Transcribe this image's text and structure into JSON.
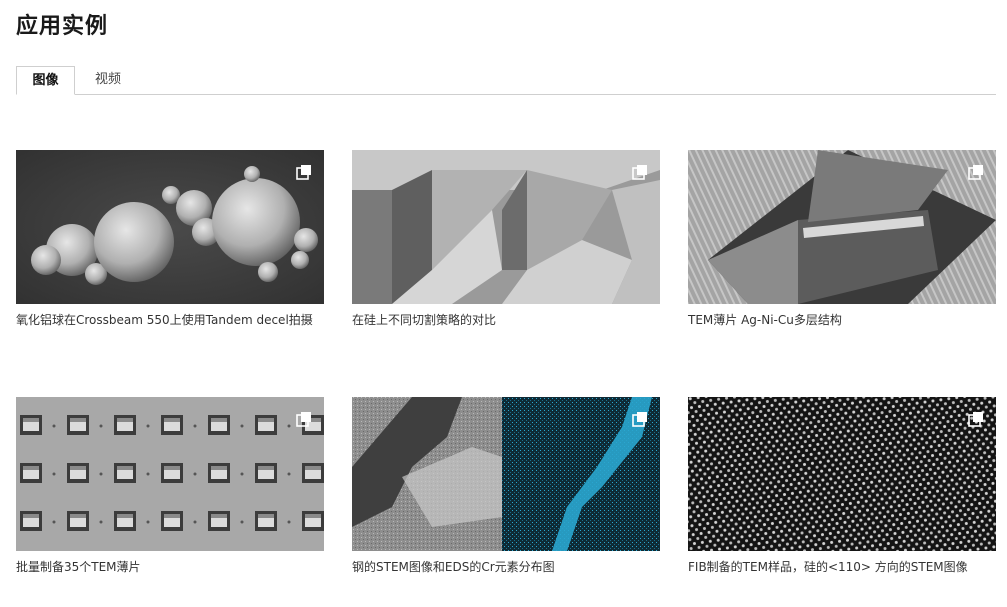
{
  "page": {
    "title": "应用实例"
  },
  "tabs": [
    {
      "label": "图像",
      "active": true
    },
    {
      "label": "视频",
      "active": false
    }
  ],
  "gallery": [
    {
      "caption": "氧化铝球在Crossbeam 550上使用Tandem decel拍摄",
      "icon": "expand-icon"
    },
    {
      "caption": "在硅上不同切割策略的对比",
      "icon": "expand-icon"
    },
    {
      "caption": "TEM薄片 Ag-Ni-Cu多层结构",
      "icon": "expand-icon"
    },
    {
      "caption": "批量制备35个TEM薄片",
      "icon": "expand-icon"
    },
    {
      "caption": "钢的STEM图像和EDS的Cr元素分布图",
      "icon": "expand-icon"
    },
    {
      "caption": "FIB制备的TEM样品，硅的<110> 方向的STEM图像",
      "icon": "expand-icon"
    }
  ],
  "colors": {
    "eds_map": "#2aa6cf",
    "tab_border": "#cfcfcf",
    "caption_text": "#333333"
  }
}
